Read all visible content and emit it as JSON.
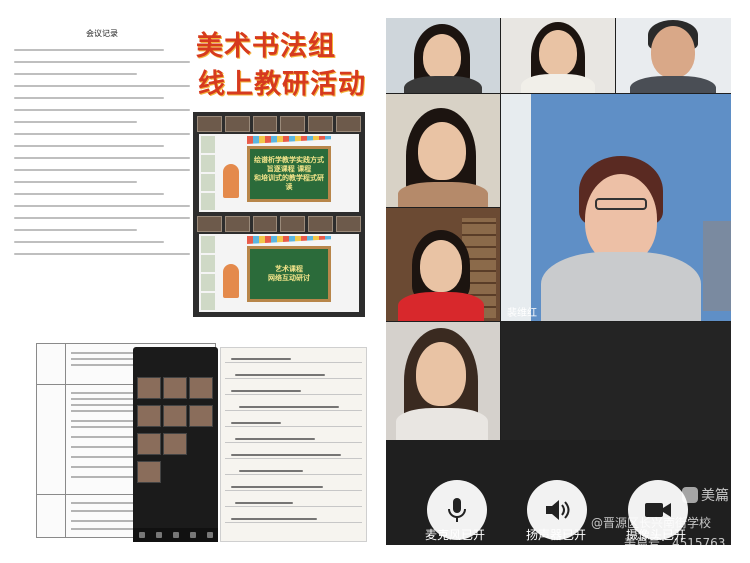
{
  "meeting_doc": {
    "title": "会议记录"
  },
  "poster": {
    "line1": "美术书法组",
    "line2": "线上教研活动"
  },
  "slides": {
    "slide1": "绘谱析学教学实践方式\n旨逐课程 课程\n和培训式的教学程式研\n读",
    "slide2": "艺术课程\n网络互动研讨"
  },
  "conference": {
    "participant_name": "裴维红",
    "controls": {
      "mic_label": "麦克风已开",
      "speaker_label": "扬声器已开",
      "camera_label": "摄像头已开"
    },
    "watermark_org": "@晋源区长兴南街学校",
    "watermark_app": "美篇",
    "watermark_id": "美篇号：4515763"
  },
  "colors": {
    "poster_red": "#d63a1e",
    "conf_bg": "#1f1f1f",
    "control_bg": "#f2f2f2"
  },
  "icons": [
    "microphone-icon",
    "speaker-icon",
    "camera-icon"
  ]
}
